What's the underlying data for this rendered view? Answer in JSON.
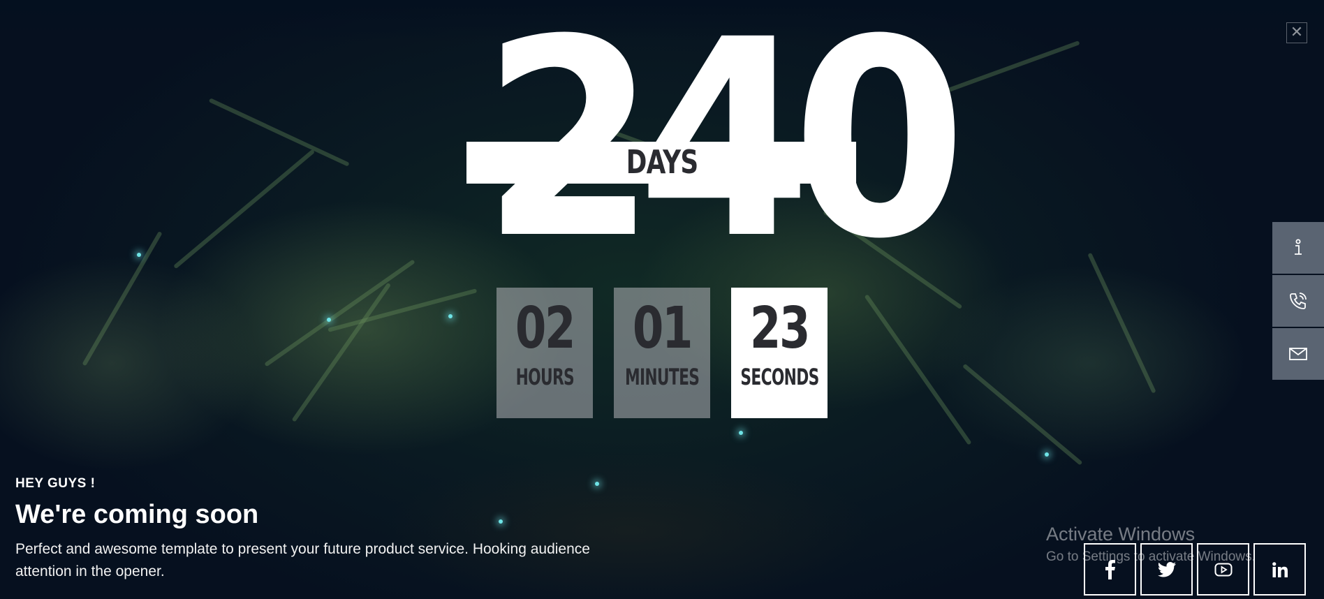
{
  "countdown": {
    "days": "240",
    "days_label": "DAYS",
    "hours": "02",
    "hours_label": "HOURS",
    "minutes": "01",
    "minutes_label": "MINUTES",
    "seconds": "23",
    "seconds_label": "SECONDS"
  },
  "intro": {
    "kicker": "HEY GUYS !",
    "headline": "We're coming soon",
    "description": "Perfect and awesome template to present your future product service. Hooking audience attention in the opener."
  },
  "side_menu": [
    {
      "icon": "info-icon"
    },
    {
      "icon": "phone-icon"
    },
    {
      "icon": "mail-icon"
    }
  ],
  "social": [
    {
      "icon": "facebook-icon"
    },
    {
      "icon": "twitter-icon"
    },
    {
      "icon": "youtube-icon"
    },
    {
      "icon": "linkedin-icon"
    }
  ],
  "watermark": {
    "title": "Activate Windows",
    "subtitle": "Go to Settings to activate Windows."
  },
  "colors": {
    "background": "#06101f",
    "box_dim": "#b4b4b9",
    "box_lit": "#ffffff",
    "text_dark": "#2a2b30",
    "side_tab": "#5a6472"
  }
}
